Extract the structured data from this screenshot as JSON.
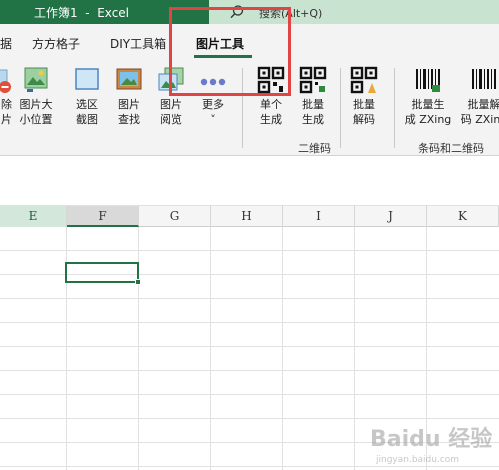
{
  "window": {
    "title": "工作簿1  -  Excel"
  },
  "search": {
    "placeholder": "搜索(Alt+Q)"
  },
  "tabs": [
    {
      "label": "据"
    },
    {
      "label": "方方格子"
    },
    {
      "label": "DIY工具箱"
    },
    {
      "label": "图片工具",
      "active": true
    }
  ],
  "ribbon": {
    "buttons": [
      {
        "label": "除\n片",
        "icon": "delete-image-icon"
      },
      {
        "label": "图片大\n小位置",
        "icon": "image-size-icon"
      },
      {
        "label": "选区\n截图",
        "icon": "screenshot-icon"
      },
      {
        "label": "图片\n查找",
        "icon": "image-find-icon"
      },
      {
        "label": "图片\n阅览",
        "icon": "image-preview-icon"
      },
      {
        "label": "更多\n˅",
        "icon": "more-dots-icon"
      },
      {
        "label": "单个\n生成",
        "icon": "qr-single-icon"
      },
      {
        "label": "批量\n生成",
        "icon": "qr-batch-icon"
      },
      {
        "label": "批量\n解码",
        "icon": "qr-decode-icon"
      },
      {
        "label": "批量生\n成 ZXing",
        "icon": "barcode-generate-icon"
      },
      {
        "label": "批量解\n码 ZXing",
        "icon": "barcode-decode-icon"
      }
    ],
    "groups": [
      {
        "label": "二维码"
      },
      {
        "label": "条码和二维码"
      }
    ]
  },
  "sheet": {
    "columns": [
      "E",
      "F",
      "G",
      "H",
      "I",
      "J",
      "K"
    ],
    "selected_column": "E",
    "active_column": "F"
  },
  "watermark": {
    "text": "Baidu 经验",
    "sub": "jingyan.baidu.com"
  },
  "colors": {
    "accent": "#217346",
    "highlight": "#e04444"
  }
}
